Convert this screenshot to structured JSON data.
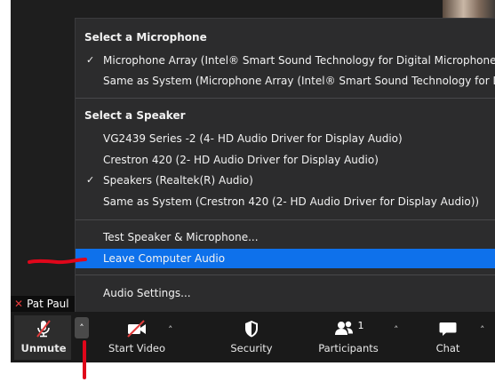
{
  "participant_name": "Pat Paul",
  "audio_menu": {
    "mic_heading": "Select a Microphone",
    "mic_items": [
      {
        "label": "Microphone Array (Intel® Smart Sound Technology for Digital Microphones)",
        "checked": true
      },
      {
        "label": "Same as System (Microphone Array (Intel® Smart Sound Technology for Digital Microphones))",
        "checked": false
      }
    ],
    "speaker_heading": "Select a Speaker",
    "speaker_items": [
      {
        "label": "VG2439 Series -2 (4- HD Audio Driver for Display Audio)",
        "checked": false
      },
      {
        "label": "Crestron 420 (2- HD Audio Driver for Display Audio)",
        "checked": false
      },
      {
        "label": "Speakers (Realtek(R) Audio)",
        "checked": true
      },
      {
        "label": "Same as System (Crestron 420 (2- HD Audio Driver for Display Audio))",
        "checked": false
      }
    ],
    "test_label": "Test Speaker & Microphone...",
    "leave_label": "Leave Computer Audio",
    "settings_label": "Audio Settings...",
    "highlight_color": "#0e71eb"
  },
  "toolbar": {
    "unmute_label": "Unmute",
    "start_video_label": "Start Video",
    "security_label": "Security",
    "participants_label": "Participants",
    "participants_count": "1",
    "chat_label": "Chat"
  },
  "colors": {
    "annotation_red": "#e0061a",
    "muted_red": "#e03a3a"
  },
  "icons": [
    "mic-muted-icon",
    "video-off-icon",
    "shield-icon",
    "participants-icon",
    "chat-icon",
    "checkmark-icon",
    "caret-up-icon"
  ]
}
